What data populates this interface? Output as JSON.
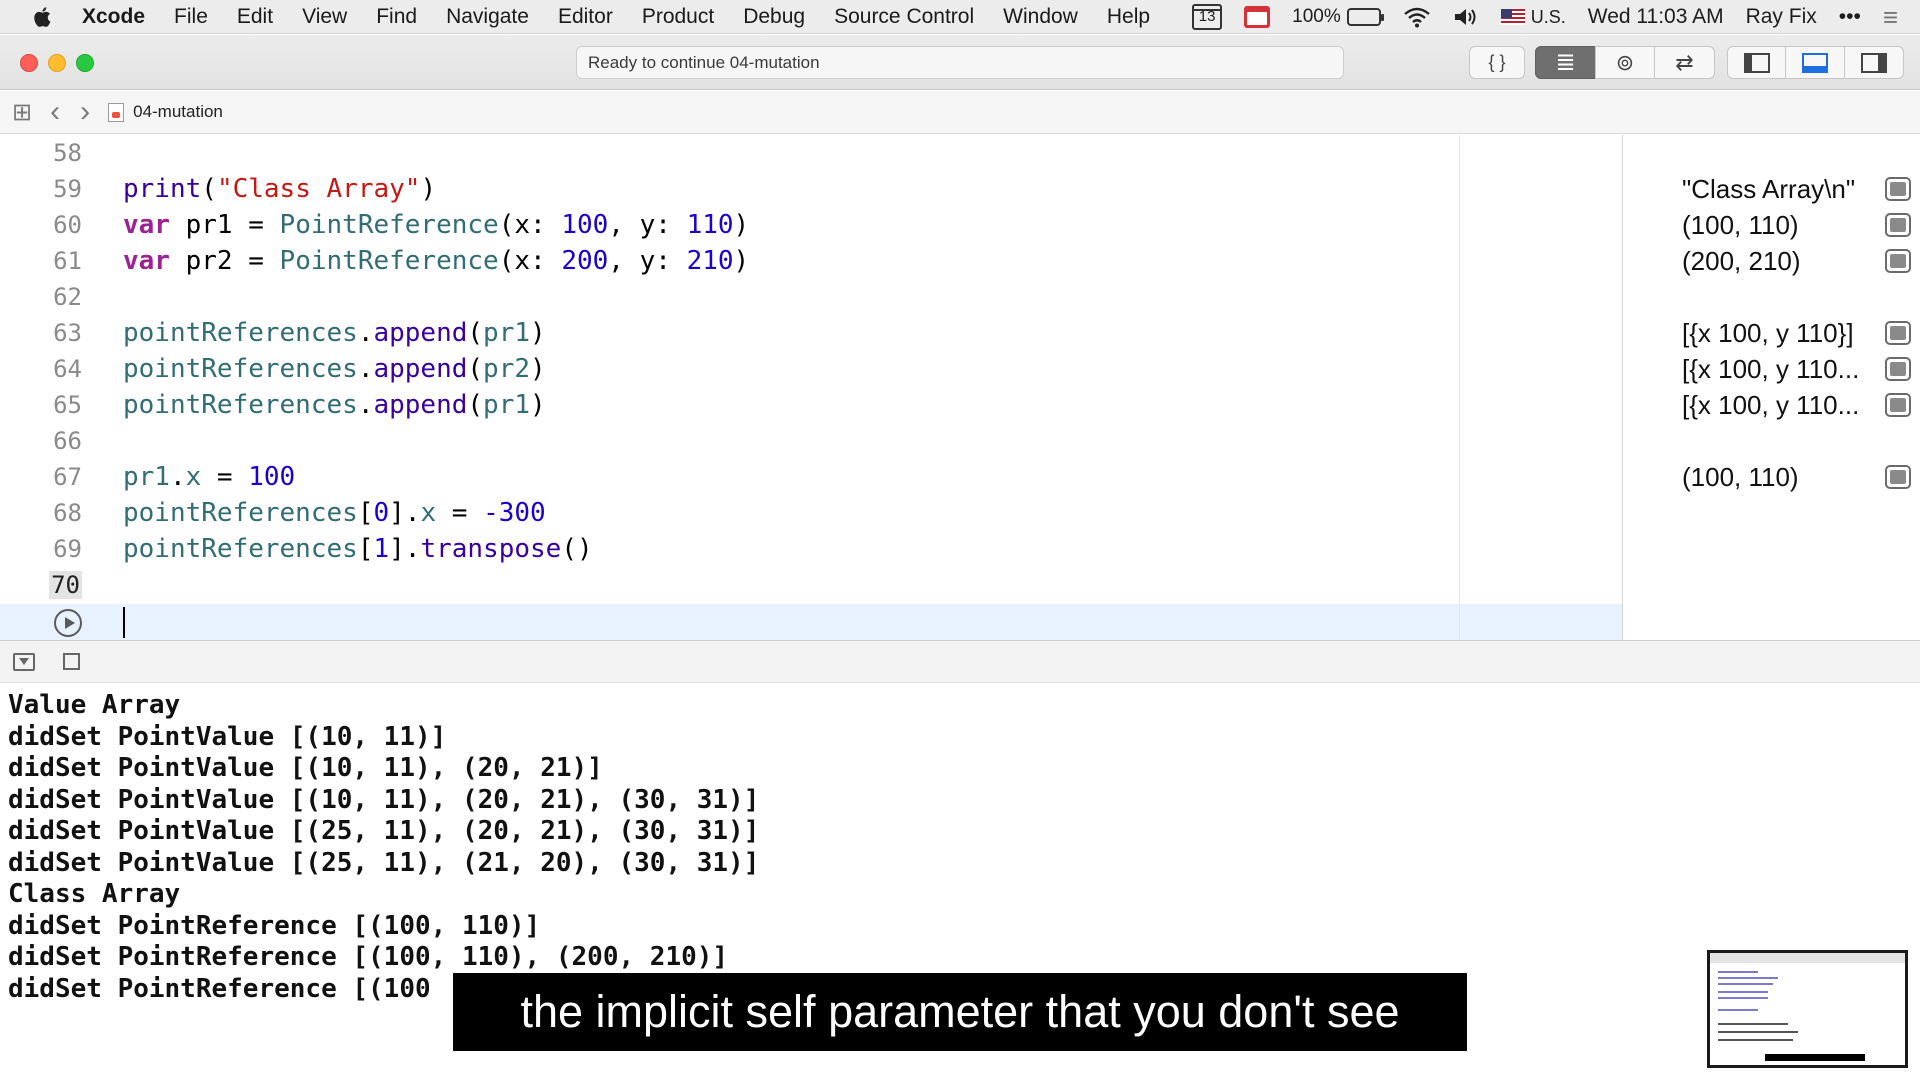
{
  "menubar": {
    "app": "Xcode",
    "menus": [
      "File",
      "Edit",
      "View",
      "Find",
      "Navigate",
      "Editor",
      "Product",
      "Debug",
      "Source Control",
      "Window",
      "Help"
    ],
    "calendar_day": "13",
    "battery_percent": "100%",
    "input_source": "U.S.",
    "clock": "Wed 11:03 AM",
    "user": "Ray Fix",
    "more": "•••",
    "list_icon": "≡"
  },
  "toolbar": {
    "activity_text": "Ready to continue 04-mutation",
    "buttons": {
      "library": "{ }",
      "standard_editor": "≣",
      "assistant_editor": "⊚",
      "version_editor": "⇄"
    }
  },
  "jumpbar": {
    "related_items": "⊞",
    "back": "‹",
    "forward": "›",
    "file": "04-mutation"
  },
  "code": [
    {
      "ln": "58",
      "tokens": []
    },
    {
      "ln": "59",
      "tokens": [
        [
          "m",
          "print"
        ],
        [
          "p",
          "("
        ],
        [
          "s",
          "\"Class Array\""
        ],
        [
          "p",
          ")"
        ]
      ]
    },
    {
      "ln": "60",
      "tokens": [
        [
          "k",
          "var"
        ],
        [
          "p",
          " pr1 = "
        ],
        [
          "t",
          "PointReference"
        ],
        [
          "p",
          "(x: "
        ],
        [
          "n",
          "100"
        ],
        [
          "p",
          ", y: "
        ],
        [
          "n",
          "110"
        ],
        [
          "p",
          ")"
        ]
      ]
    },
    {
      "ln": "61",
      "tokens": [
        [
          "k",
          "var"
        ],
        [
          "p",
          " pr2 = "
        ],
        [
          "t",
          "PointReference"
        ],
        [
          "p",
          "(x: "
        ],
        [
          "n",
          "200"
        ],
        [
          "p",
          ", y: "
        ],
        [
          "n",
          "210"
        ],
        [
          "p",
          ")"
        ]
      ]
    },
    {
      "ln": "62",
      "tokens": []
    },
    {
      "ln": "63",
      "tokens": [
        [
          "t",
          "pointReferences"
        ],
        [
          "p",
          "."
        ],
        [
          "m",
          "append"
        ],
        [
          "p",
          "("
        ],
        [
          "t",
          "pr1"
        ],
        [
          "p",
          ")"
        ]
      ]
    },
    {
      "ln": "64",
      "tokens": [
        [
          "t",
          "pointReferences"
        ],
        [
          "p",
          "."
        ],
        [
          "m",
          "append"
        ],
        [
          "p",
          "("
        ],
        [
          "t",
          "pr2"
        ],
        [
          "p",
          ")"
        ]
      ]
    },
    {
      "ln": "65",
      "tokens": [
        [
          "t",
          "pointReferences"
        ],
        [
          "p",
          "."
        ],
        [
          "m",
          "append"
        ],
        [
          "p",
          "("
        ],
        [
          "t",
          "pr1"
        ],
        [
          "p",
          ")"
        ]
      ]
    },
    {
      "ln": "66",
      "tokens": []
    },
    {
      "ln": "67",
      "tokens": [
        [
          "t",
          "pr1"
        ],
        [
          "p",
          "."
        ],
        [
          "t",
          "x"
        ],
        [
          "p",
          " = "
        ],
        [
          "n",
          "100"
        ]
      ]
    },
    {
      "ln": "68",
      "tokens": [
        [
          "t",
          "pointReferences"
        ],
        [
          "p",
          "["
        ],
        [
          "n",
          "0"
        ],
        [
          "p",
          "]."
        ],
        [
          "t",
          "x"
        ],
        [
          "p",
          " = "
        ],
        [
          "n",
          "-300"
        ]
      ]
    },
    {
      "ln": "69",
      "tokens": [
        [
          "t",
          "pointReferences"
        ],
        [
          "p",
          "["
        ],
        [
          "n",
          "1"
        ],
        [
          "p",
          "]."
        ],
        [
          "m",
          "transpose"
        ],
        [
          "p",
          "()"
        ]
      ]
    },
    {
      "ln": "70",
      "tokens": []
    }
  ],
  "current_line": "70",
  "results": [
    {
      "ln": "59",
      "text": "\"Class Array\\n\""
    },
    {
      "ln": "60",
      "text": "(100, 110)"
    },
    {
      "ln": "61",
      "text": "(200, 210)"
    },
    {
      "ln": "63",
      "text": "[{x 100, y 110}]"
    },
    {
      "ln": "64",
      "text": "[{x 100, y 110..."
    },
    {
      "ln": "65",
      "text": "[{x 100, y 110..."
    },
    {
      "ln": "67",
      "text": "(100, 110)"
    }
  ],
  "console": [
    "Value Array",
    "didSet PointValue [(10, 11)]",
    "didSet PointValue [(10, 11), (20, 21)]",
    "didSet PointValue [(10, 11), (20, 21), (30, 31)]",
    "didSet PointValue [(25, 11), (20, 21), (30, 31)]",
    "didSet PointValue [(25, 11), (21, 20), (30, 31)]",
    "Class Array",
    "didSet PointReference [(100, 110)]",
    "didSet PointReference [(100, 110), (200, 210)]",
    "didSet PointReference [(100"
  ],
  "caption": "the implicit self parameter that you don't see",
  "colors": {
    "keyword": "#9b2393",
    "string": "#c41a16",
    "number": "#1c00cf",
    "identifier": "#326d74",
    "method": "#3900a0",
    "active_line": "#e8f2ff"
  }
}
